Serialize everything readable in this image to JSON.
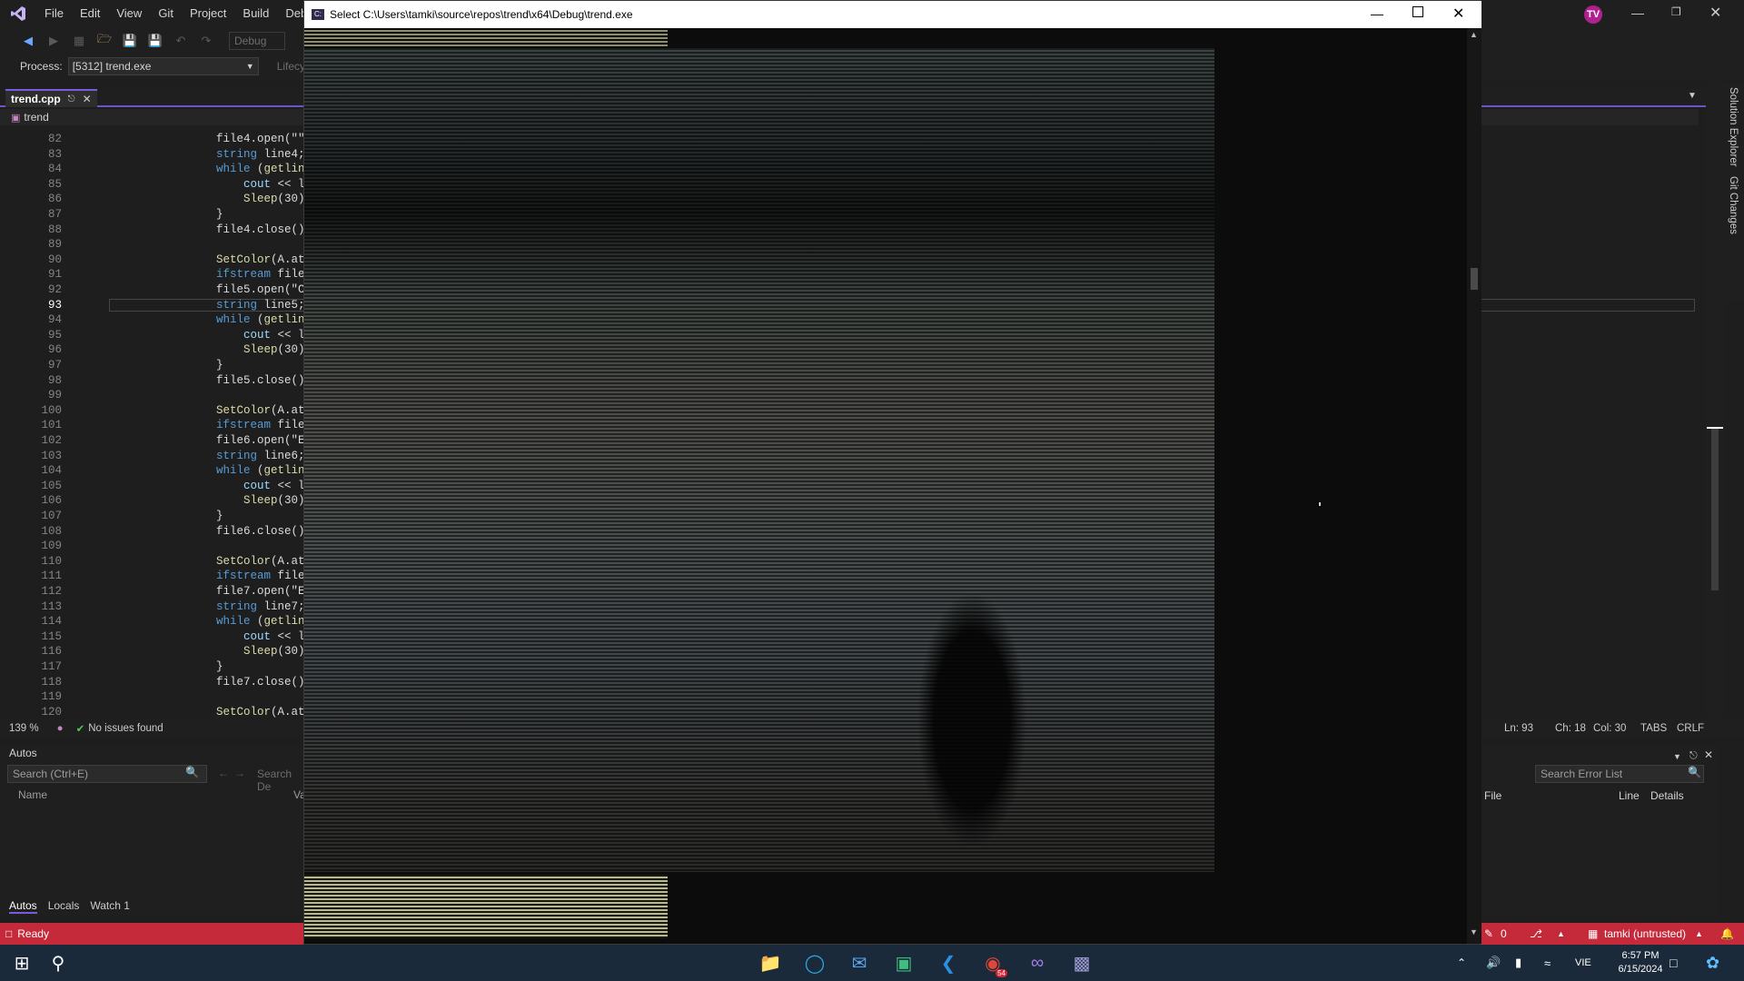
{
  "vs": {
    "menu": [
      "File",
      "Edit",
      "View",
      "Git",
      "Project",
      "Build",
      "Debu"
    ],
    "toolbar": {
      "config": "Debug",
      "lifecycle": "Lifecyc"
    },
    "process": {
      "label": "Process:",
      "value": "[5312] trend.exe"
    },
    "user_initials": "TV",
    "tab": {
      "name": "trend.cpp"
    },
    "nav_scope": "trend",
    "side_tabs": [
      "Solution Explorer",
      "Git Changes"
    ],
    "code_lines": [
      {
        "n": "82",
        "text": "file4.open(\"\""
      },
      {
        "n": "83",
        "text": "string line4;"
      },
      {
        "n": "84",
        "text": "while (getlin"
      },
      {
        "n": "85",
        "text": "    cout << l"
      },
      {
        "n": "86",
        "text": "    Sleep(30)"
      },
      {
        "n": "87",
        "text": "}"
      },
      {
        "n": "88",
        "text": "file4.close()"
      },
      {
        "n": "89",
        "text": ""
      },
      {
        "n": "90",
        "text": "SetColor(A.at"
      },
      {
        "n": "91",
        "text": "ifstream file"
      },
      {
        "n": "92",
        "text": "file5.open(\"C"
      },
      {
        "n": "93",
        "text": "string line5;"
      },
      {
        "n": "94",
        "text": "while (getlin"
      },
      {
        "n": "95",
        "text": "    cout << l"
      },
      {
        "n": "96",
        "text": "    Sleep(30)"
      },
      {
        "n": "97",
        "text": "}"
      },
      {
        "n": "98",
        "text": "file5.close()"
      },
      {
        "n": "99",
        "text": ""
      },
      {
        "n": "100",
        "text": "SetColor(A.at"
      },
      {
        "n": "101",
        "text": "ifstream file"
      },
      {
        "n": "102",
        "text": "file6.open(\"E"
      },
      {
        "n": "103",
        "text": "string line6;"
      },
      {
        "n": "104",
        "text": "while (getlin"
      },
      {
        "n": "105",
        "text": "    cout << l"
      },
      {
        "n": "106",
        "text": "    Sleep(30)"
      },
      {
        "n": "107",
        "text": "}"
      },
      {
        "n": "108",
        "text": "file6.close()"
      },
      {
        "n": "109",
        "text": ""
      },
      {
        "n": "110",
        "text": "SetColor(A.at"
      },
      {
        "n": "111",
        "text": "ifstream file"
      },
      {
        "n": "112",
        "text": "file7.open(\"E"
      },
      {
        "n": "113",
        "text": "string line7;"
      },
      {
        "n": "114",
        "text": "while (getlin"
      },
      {
        "n": "115",
        "text": "    cout << l"
      },
      {
        "n": "116",
        "text": "    Sleep(30)"
      },
      {
        "n": "117",
        "text": "}"
      },
      {
        "n": "118",
        "text": "file7.close()"
      },
      {
        "n": "119",
        "text": ""
      },
      {
        "n": "120",
        "text": "SetColor(A.at"
      }
    ],
    "current_line": "93",
    "editor_status": {
      "zoom": "139 %",
      "issues": "No issues found",
      "ln": "Ln: 93",
      "ch": "Ch: 18",
      "col": "Col: 30",
      "tabs": "TABS",
      "eol": "CRLF"
    },
    "autos": {
      "title": "Autos",
      "search_placeholder": "Search (Ctrl+E)",
      "search_depth": "Search De",
      "col_name": "Name",
      "col_value": "Va",
      "tabs": [
        "Autos",
        "Locals",
        "Watch 1"
      ]
    },
    "errors": {
      "search_placeholder": "Search Error List",
      "col_file": "File",
      "col_line": "Line",
      "col_details": "Details"
    },
    "status": {
      "text": "Ready",
      "errors": "0",
      "repo": "tamki (untrusted)"
    }
  },
  "console": {
    "title": "Select C:\\Users\\tamki\\source\\repos\\trend\\x64\\Debug\\trend.exe"
  },
  "taskbar": {
    "language": "VIE",
    "time": "6:57 PM",
    "date": "6/15/2024",
    "chrome_badge": "54"
  }
}
